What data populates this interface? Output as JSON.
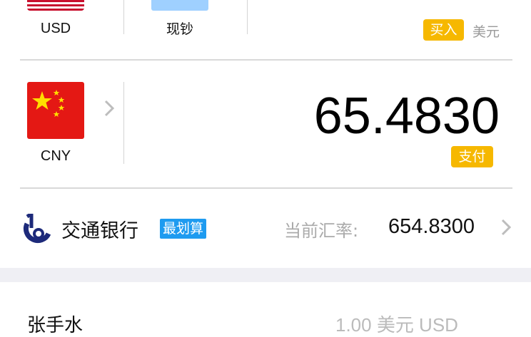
{
  "from": {
    "currency_code": "USD",
    "cash_type_label": "现钞",
    "action_badge": "买入",
    "currency_name": "美元"
  },
  "to": {
    "currency_code": "CNY",
    "amount": "65.4830",
    "action_badge": "支付"
  },
  "bank": {
    "name": "交通银行",
    "tag": "最划算",
    "rate_label": "当前汇率:",
    "rate_value": "654.8300"
  },
  "next_row": {
    "left_text": "张手水",
    "right_text": "1.00 美元 USD"
  },
  "colors": {
    "accent_yellow": "#f6b800",
    "tag_blue": "#1e9bf0",
    "bank_logo_blue": "#1d2a7a",
    "cny_red": "#e41814"
  },
  "icons": {
    "chevron": "chevron-right-icon",
    "bank_logo": "bank-logo-icon"
  }
}
